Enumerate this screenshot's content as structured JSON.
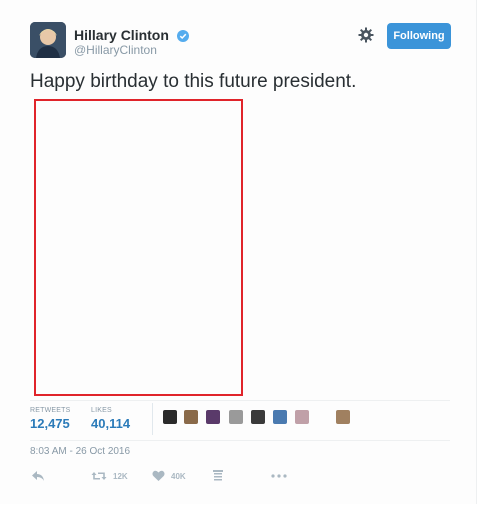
{
  "header": {
    "name": "Hillary Clinton",
    "handle": "@HillaryClinton",
    "follow_button_label": "Following",
    "verified": true
  },
  "tweet": {
    "text": "Happy birthday to this future president.",
    "timestamp": "8:03 AM - 26 Oct 2016"
  },
  "stats": {
    "retweets_label": "RETWEETS",
    "retweets_value": "12,475",
    "likes_label": "LIKES",
    "likes_value": "40,114"
  },
  "actions": {
    "retweet_count": "12K",
    "like_count": "40K"
  },
  "icons": [
    "verified-badge-icon",
    "gear-icon",
    "reply-icon",
    "retweet-icon",
    "heart-icon",
    "stats-icon",
    "more-icon"
  ],
  "colors": {
    "accent": "#3b94d9",
    "link": "#2b7bb9",
    "media_border": "#e0242a",
    "muted": "#8899a6"
  }
}
